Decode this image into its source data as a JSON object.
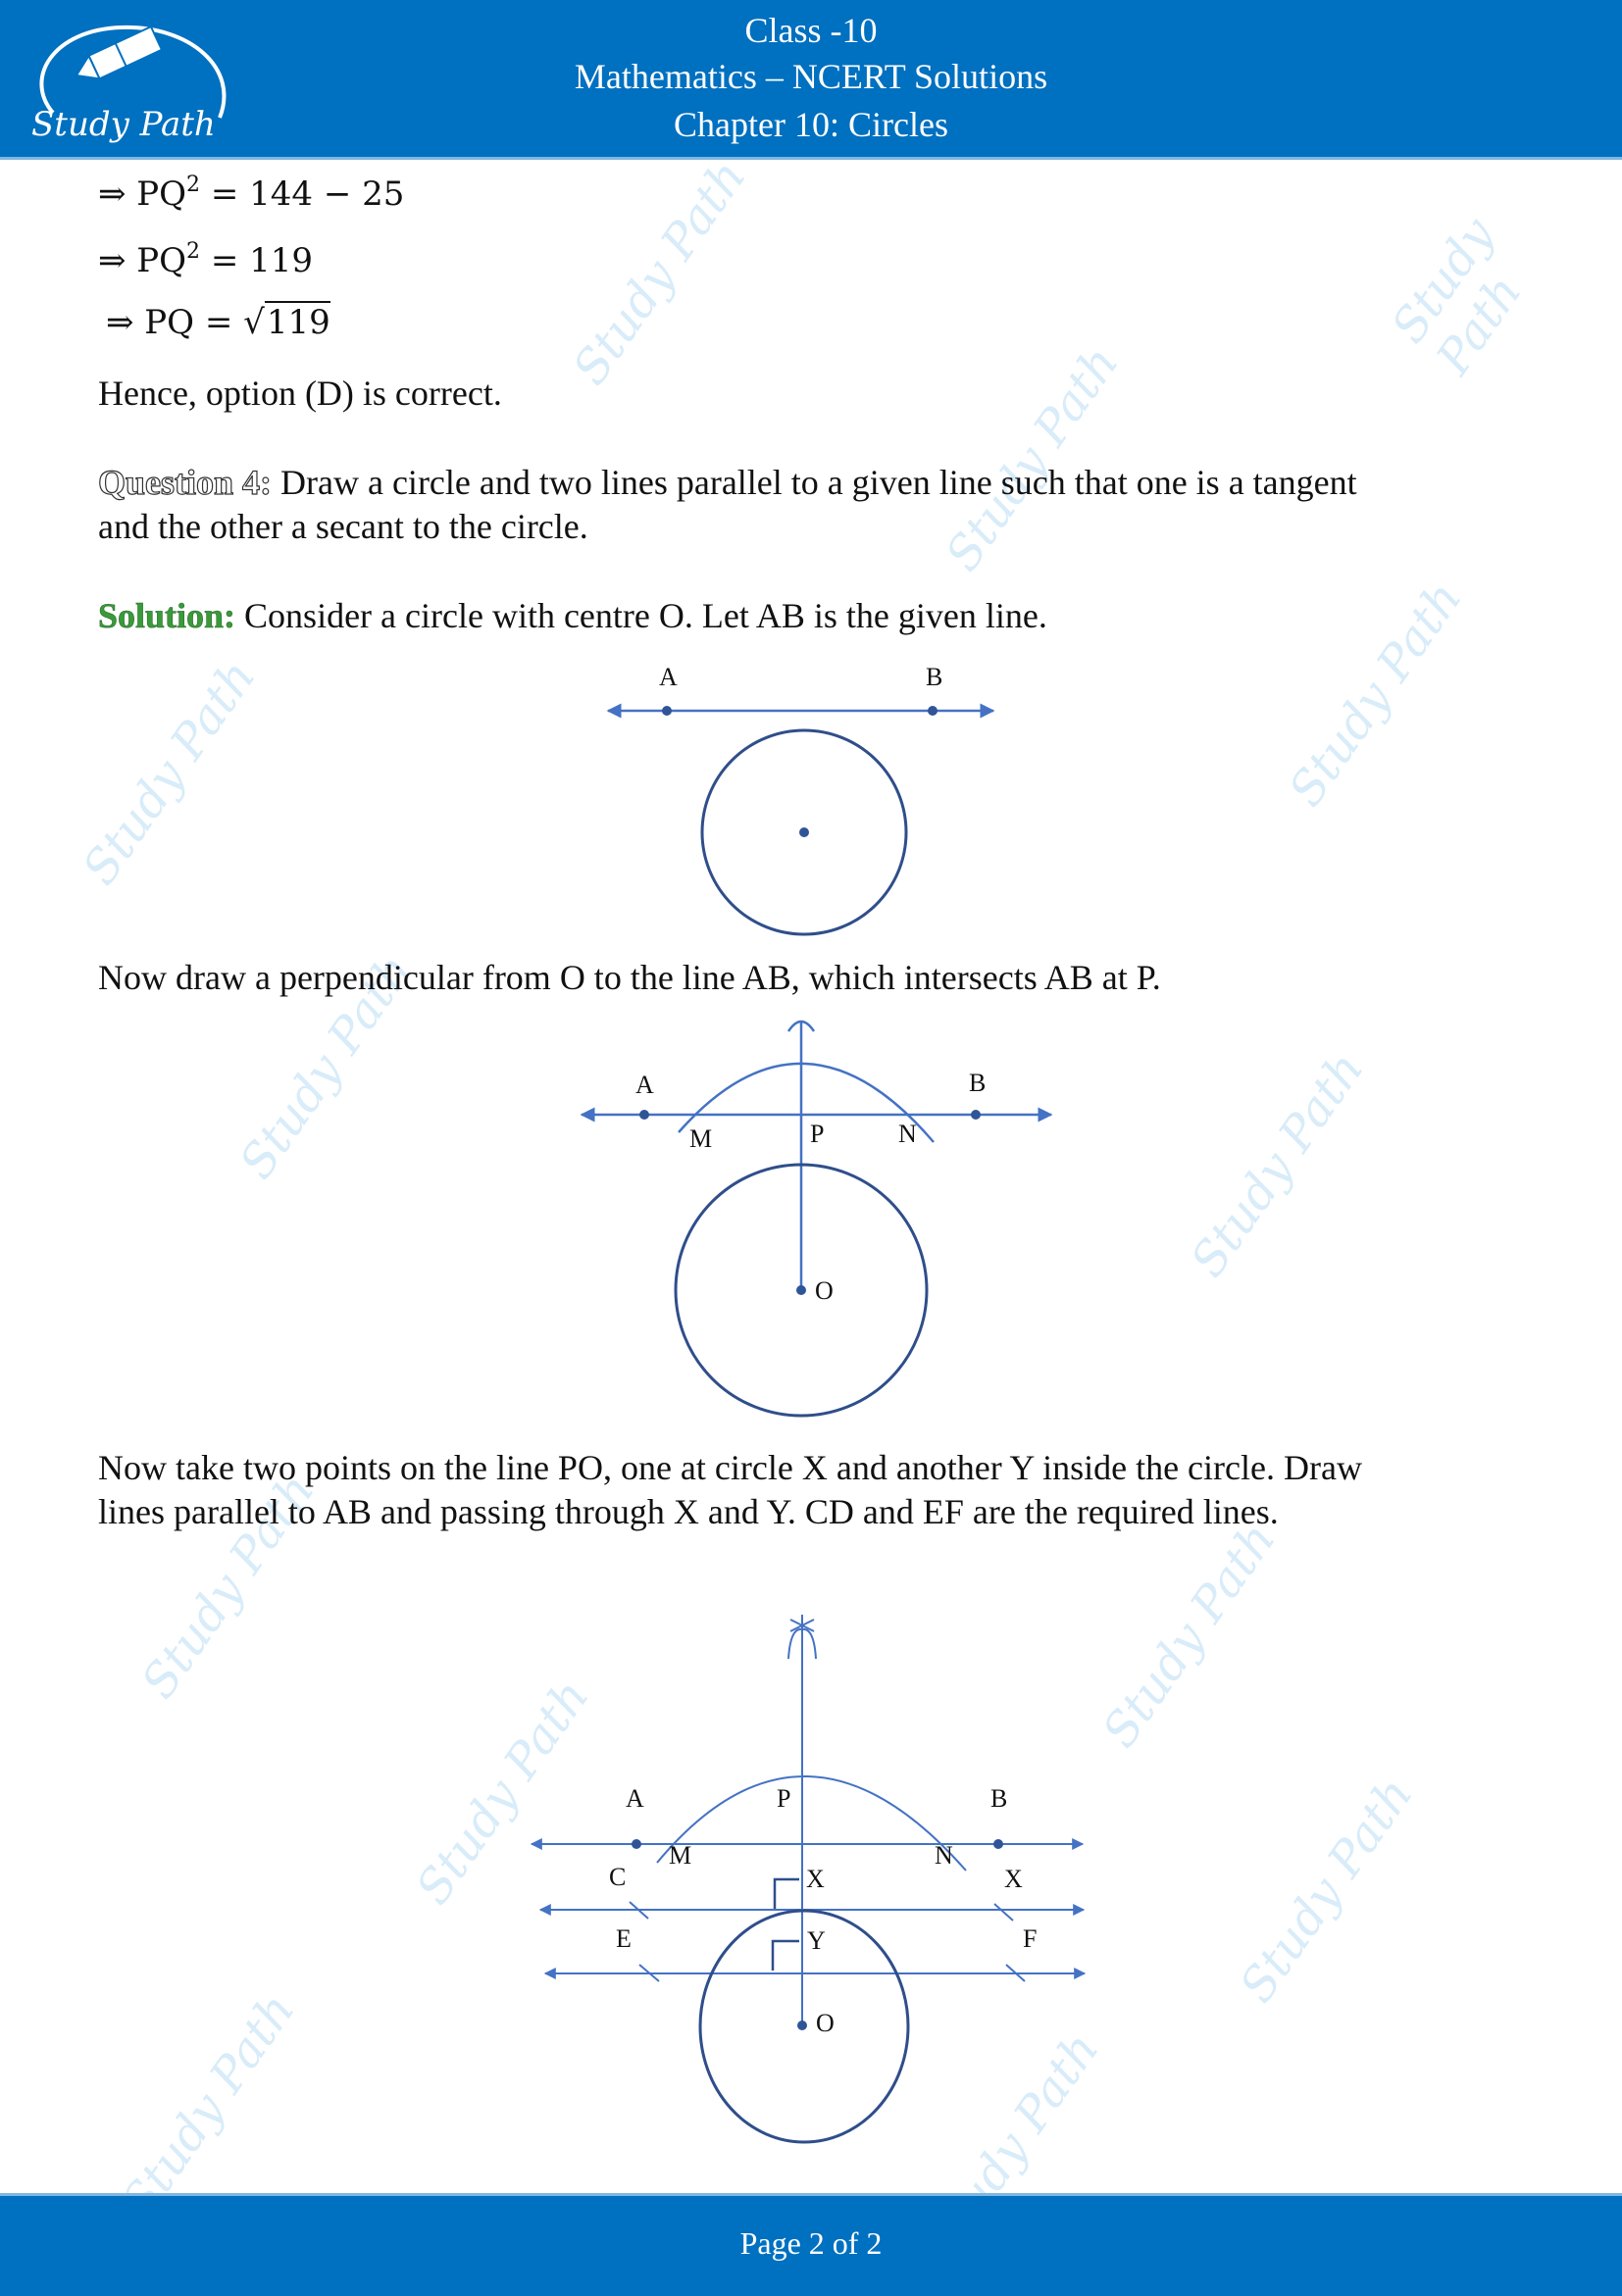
{
  "header": {
    "class_line": "Class -10",
    "subject_line": "Mathematics – NCERT Solutions",
    "chapter_line": "Chapter 10: Circles",
    "logo_text": "Study Path",
    "brand_color": "#0070c0"
  },
  "equations": [
    {
      "prefix": "⇒ PQ",
      "sup": "2",
      "rest": " = 144 − 25"
    },
    {
      "prefix": "⇒ PQ",
      "sup": "2",
      "rest": " = 119"
    },
    {
      "prefix": "⇒ PQ = √",
      "radicand": "119"
    }
  ],
  "conclusion": "Hence, option (D) is correct.",
  "question": {
    "label": "Question 4:",
    "text_line1": " Draw a circle and two lines parallel to a given line such that one is a tangent",
    "text_line2": "and the other a secant to the circle."
  },
  "solution": {
    "label": "Solution:",
    "text": " Consider a circle with centre O. Let AB is the given line.",
    "label_color": "#3a9a3a"
  },
  "step2_text": "Now draw a perpendicular from O to the line AB, which intersects AB at P.",
  "step3_text_line1": "Now take two points on the line PO, one at circle X and another Y inside the circle. Draw",
  "step3_text_line2": "lines parallel to AB and passing through X and Y. CD and EF are the required lines.",
  "diagram1": {
    "labels": {
      "a": "A",
      "b": "B"
    }
  },
  "diagram2": {
    "labels": {
      "a": "A",
      "b": "B",
      "m": "M",
      "p": "P",
      "n": "N",
      "o": "O"
    }
  },
  "diagram3": {
    "labels": {
      "a": "A",
      "b": "B",
      "p": "P",
      "m": "M",
      "n": "N",
      "c": "C",
      "x1": "X",
      "x2": "X",
      "e": "E",
      "y": "Y",
      "f": "F",
      "o": "O"
    }
  },
  "watermark": "Study Path",
  "footer": {
    "page_text": "Page 2 of 2"
  }
}
